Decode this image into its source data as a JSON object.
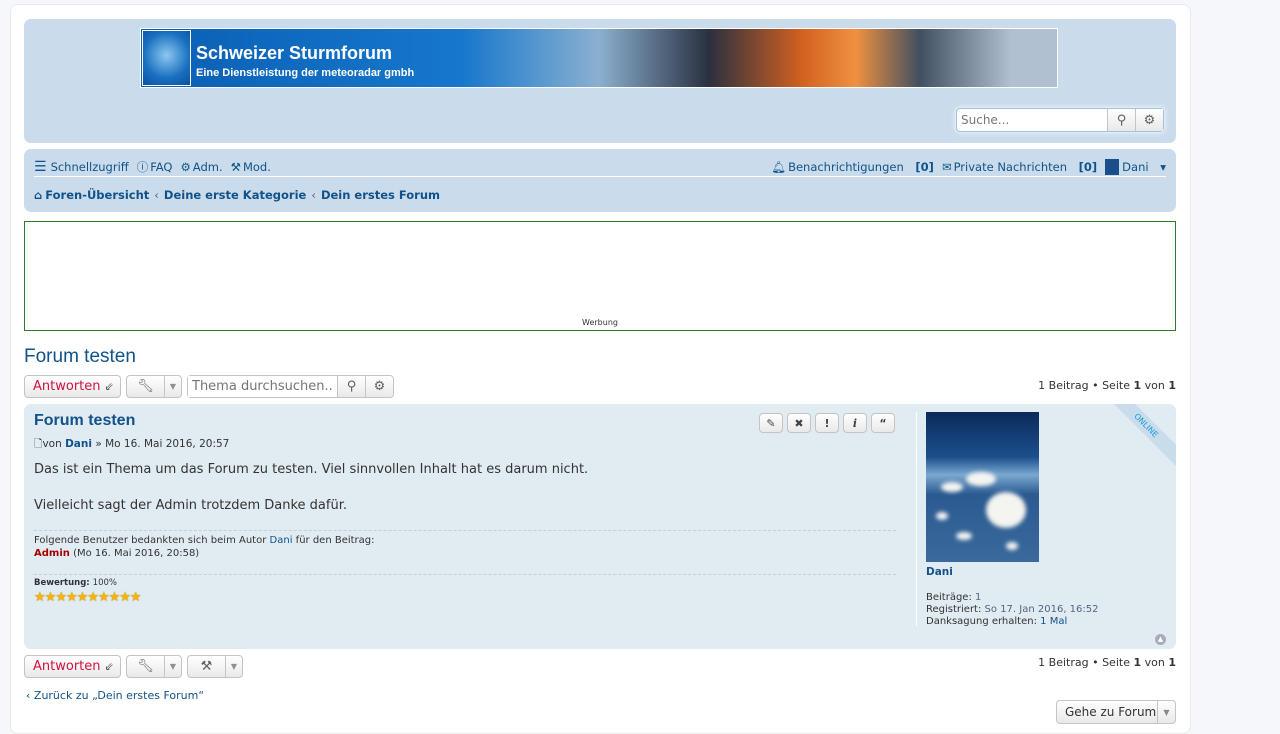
{
  "header": {
    "site_title": "Schweizer Sturmforum",
    "site_subtitle": "Eine Dienstleistung der meteoradar gmbh",
    "search_placeholder": "Suche..."
  },
  "nav": {
    "quick_access": "Schnellzugriff",
    "faq": "FAQ",
    "adm": "Adm.",
    "mod": "Mod.",
    "notifications": "Benachrichtigungen",
    "notifications_count": "[0]",
    "private_messages": "Private Nachrichten",
    "pm_count": "[0]",
    "user": "Dani"
  },
  "breadcrumbs": [
    "Foren-Übersicht",
    "Deine erste Kategorie",
    "Dein erstes Forum"
  ],
  "ad": {
    "label": "Werbung"
  },
  "topic": {
    "title": "Forum testen",
    "reply_label": "Antworten",
    "search_placeholder": "Thema durchsuchen...",
    "pagination_pre": "1 Beitrag • Seite ",
    "page": "1",
    "of": " von ",
    "pages": "1"
  },
  "post": {
    "title": "Forum testen",
    "by": "von",
    "author": "Dani",
    "date": "» Mo 16. Mai 2016, 20:57",
    "paragraphs": [
      "Das ist ein Thema um das Forum zu testen. Viel sinnvollen Inhalt hat es darum nicht.",
      "Vielleicht sagt der Admin trotzdem Danke dafür."
    ],
    "thanks_pre": "Folgende Benutzer bedankten sich beim Autor",
    "thanks_author": "Dani",
    "thanks_post": "für den Beitrag:",
    "thanks_user": "Admin",
    "thanks_date": "(Mo 16. Mai 2016, 20:58)",
    "rating_label": "Bewertung:",
    "rating_value": "100%",
    "rating_stars": 10,
    "profile": {
      "name": "Dani",
      "status": "ONLINE",
      "posts_label": "Beiträge:",
      "posts": "1",
      "registered_label": "Registriert:",
      "registered": "So 17. Jan 2016, 16:52",
      "thanks_label": "Danksagung erhalten:",
      "thanks": "1 Mal"
    }
  },
  "footer": {
    "back": "Zurück zu „Dein erstes Forum“",
    "goto": "Gehe zu Forum"
  }
}
